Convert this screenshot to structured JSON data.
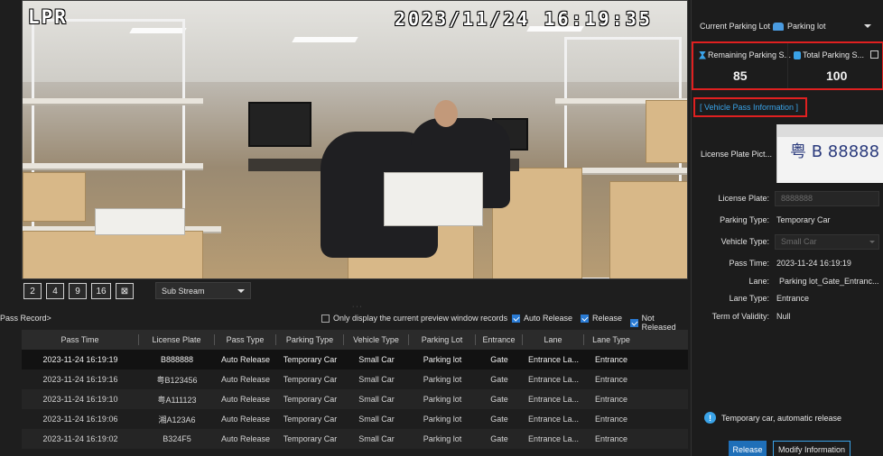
{
  "video": {
    "channel": "LPR",
    "datetime": "2023/11/24  16:19:35"
  },
  "controls": {
    "layouts": [
      "2",
      "4",
      "9",
      "16",
      "⊠"
    ],
    "stream": "Sub Stream"
  },
  "records": {
    "title": "Pass Record>",
    "filters": [
      {
        "label": "Only display the current preview window records",
        "checked": false
      },
      {
        "label": "Auto Release",
        "checked": true
      },
      {
        "label": "Release",
        "checked": true
      },
      {
        "label": "Not Released",
        "checked": true
      }
    ],
    "columns": [
      "Pass Time",
      "License Plate",
      "Pass Type",
      "Parking Type",
      "Vehicle Type",
      "Parking Lot",
      "Entrance",
      "Lane",
      "Lane Type"
    ],
    "rows": [
      [
        "2023-11-24 16:19:19",
        "B888888",
        "Auto Release",
        "Temporary Car",
        "Small Car",
        "Parking lot",
        "Gate",
        "Entrance La...",
        "Entrance"
      ],
      [
        "2023-11-24 16:19:16",
        "粤B123456",
        "Auto Release",
        "Temporary Car",
        "Small Car",
        "Parking lot",
        "Gate",
        "Entrance La...",
        "Entrance"
      ],
      [
        "2023-11-24 16:19:10",
        "粤A111123",
        "Auto Release",
        "Temporary Car",
        "Small Car",
        "Parking lot",
        "Gate",
        "Entrance La...",
        "Entrance"
      ],
      [
        "2023-11-24 16:19:06",
        "湘A123A6",
        "Auto Release",
        "Temporary Car",
        "Small Car",
        "Parking lot",
        "Gate",
        "Entrance La...",
        "Entrance"
      ],
      [
        "2023-11-24 16:19:02",
        "B324F5",
        "Auto Release",
        "Temporary Car",
        "Small Car",
        "Parking lot",
        "Gate",
        "Entrance La...",
        "Entrance"
      ]
    ]
  },
  "panel": {
    "current_lot_label": "Current Parking Lot",
    "current_lot_value": "Parking lot",
    "remaining_label": "Remaining Parking S...",
    "remaining_value": "85",
    "total_label": "Total Parking S...",
    "total_value": "100",
    "vpi_title": "[ Vehicle Pass Information ]",
    "plate_pic_label": "License Plate Pict...",
    "plate_pic_text": "粤 B 88888",
    "license_plate_label": "License Plate:",
    "license_plate_value": "8888888",
    "parking_type_label": "Parking Type:",
    "parking_type_value": "Temporary Car",
    "vehicle_type_label": "Vehicle Type:",
    "vehicle_type_value": "Small Car",
    "pass_time_label": "Pass Time:",
    "pass_time_value": "2023-11-24 16:19:19",
    "lane_label": "Lane:",
    "lane_value": "Parking lot_Gate_Entranc...",
    "lane_type_label": "Lane Type:",
    "lane_type_value": "Entrance",
    "validity_label": "Term of Validity:",
    "validity_value": "Null",
    "status_text": "Temporary car, automatic release",
    "release_label": "Release",
    "modify_label": "Modify Information"
  }
}
